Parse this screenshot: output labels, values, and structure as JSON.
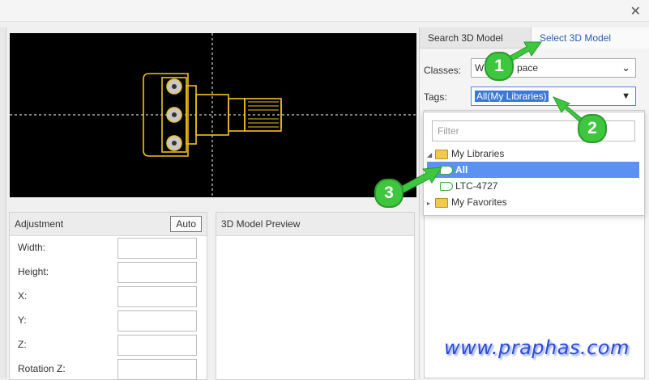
{
  "window": {
    "close_glyph": "✕"
  },
  "adjustment": {
    "title": "Adjustment",
    "auto_label": "Auto",
    "fields": [
      {
        "label": "Width:"
      },
      {
        "label": "Height:"
      },
      {
        "label": "X:"
      },
      {
        "label": "Y:"
      },
      {
        "label": "Z:"
      },
      {
        "label": "Rotation Z:"
      }
    ]
  },
  "preview": {
    "title": "3D Model Preview"
  },
  "tabs": {
    "search": "Search 3D Model",
    "select": "Select 3D Model",
    "active": "select",
    "active_color": "#2a5db0"
  },
  "form": {
    "classes_label": "Classes:",
    "classes_value": "W",
    "classes_value_tail": "pace",
    "tags_label": "Tags:",
    "tags_value": "All(My Libraries)"
  },
  "dropdown": {
    "filter_placeholder": "Filter",
    "tree": [
      {
        "label": "My Libraries",
        "icon": "folder-open-icon",
        "expanded": true
      },
      {
        "label": "All",
        "icon": "tag-icon",
        "selected": true
      },
      {
        "label": "LTC-4727",
        "icon": "tag-icon"
      },
      {
        "label": "My Favorites",
        "icon": "folder-icon",
        "expanded": false
      }
    ]
  },
  "callouts": [
    "1",
    "2",
    "3"
  ],
  "watermark": "www.praphas.com",
  "colors": {
    "selection": "#5b91f5",
    "callout": "#3ec63e",
    "footprint": "#f2c21b"
  }
}
